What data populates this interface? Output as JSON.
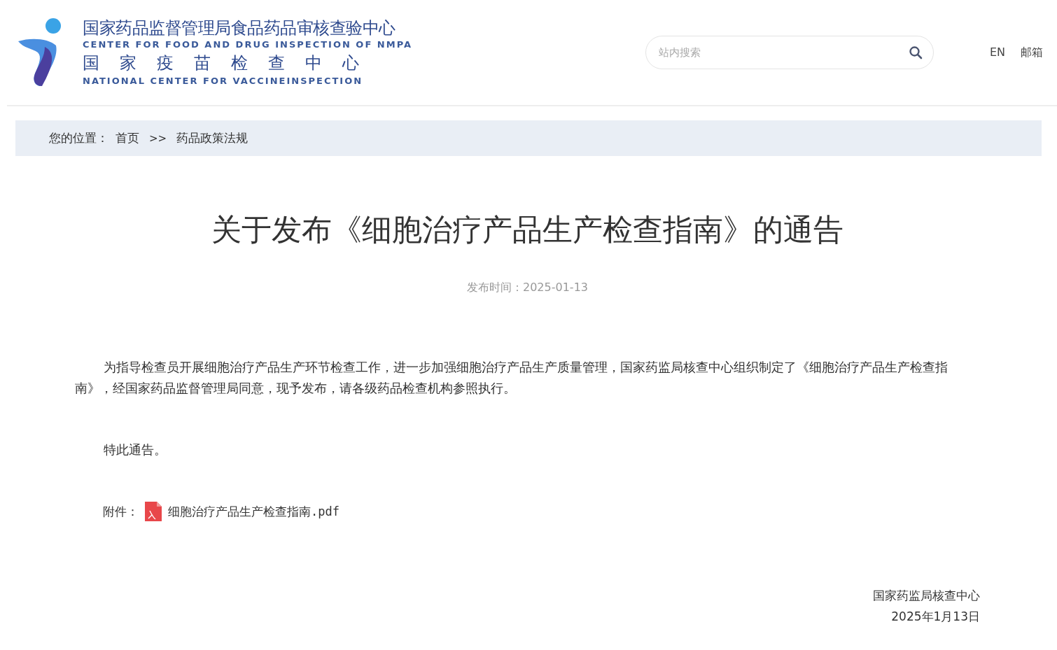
{
  "header": {
    "logo_lines": [
      "国家药品监督管理局食品药品审核查验中心",
      "CENTER FOR FOOD AND DRUG INSPECTION OF NMPA",
      "国家疫苗检查中心",
      "NATIONAL CENTER FOR VACCINEINSPECTION"
    ],
    "search": {
      "placeholder": "站内搜索"
    },
    "links": [
      "EN",
      "邮箱"
    ]
  },
  "breadcrumb": {
    "label": "您的位置：",
    "items": [
      "首页",
      "药品政策法规"
    ],
    "separator": ">>"
  },
  "article": {
    "title": "关于发布《细胞治疗产品生产检查指南》的通告",
    "date": "发布时间：2025-01-13",
    "paragraphs": [
      "为指导检查员开展细胞治疗产品生产环节检查工作，进一步加强细胞治疗产品生产质量管理，国家药监局核查中心组织制定了《细胞治疗产品生产检查指南》，经国家药品监督管理局同意，现予发布，请各级药品检查机构参照执行。",
      "特此通告。"
    ],
    "attachment": {
      "label": "附件：",
      "file": "细胞治疗产品生产检查指南.pdf"
    },
    "signature": [
      "国家药监局核查中心",
      "2025年1月13日"
    ]
  }
}
